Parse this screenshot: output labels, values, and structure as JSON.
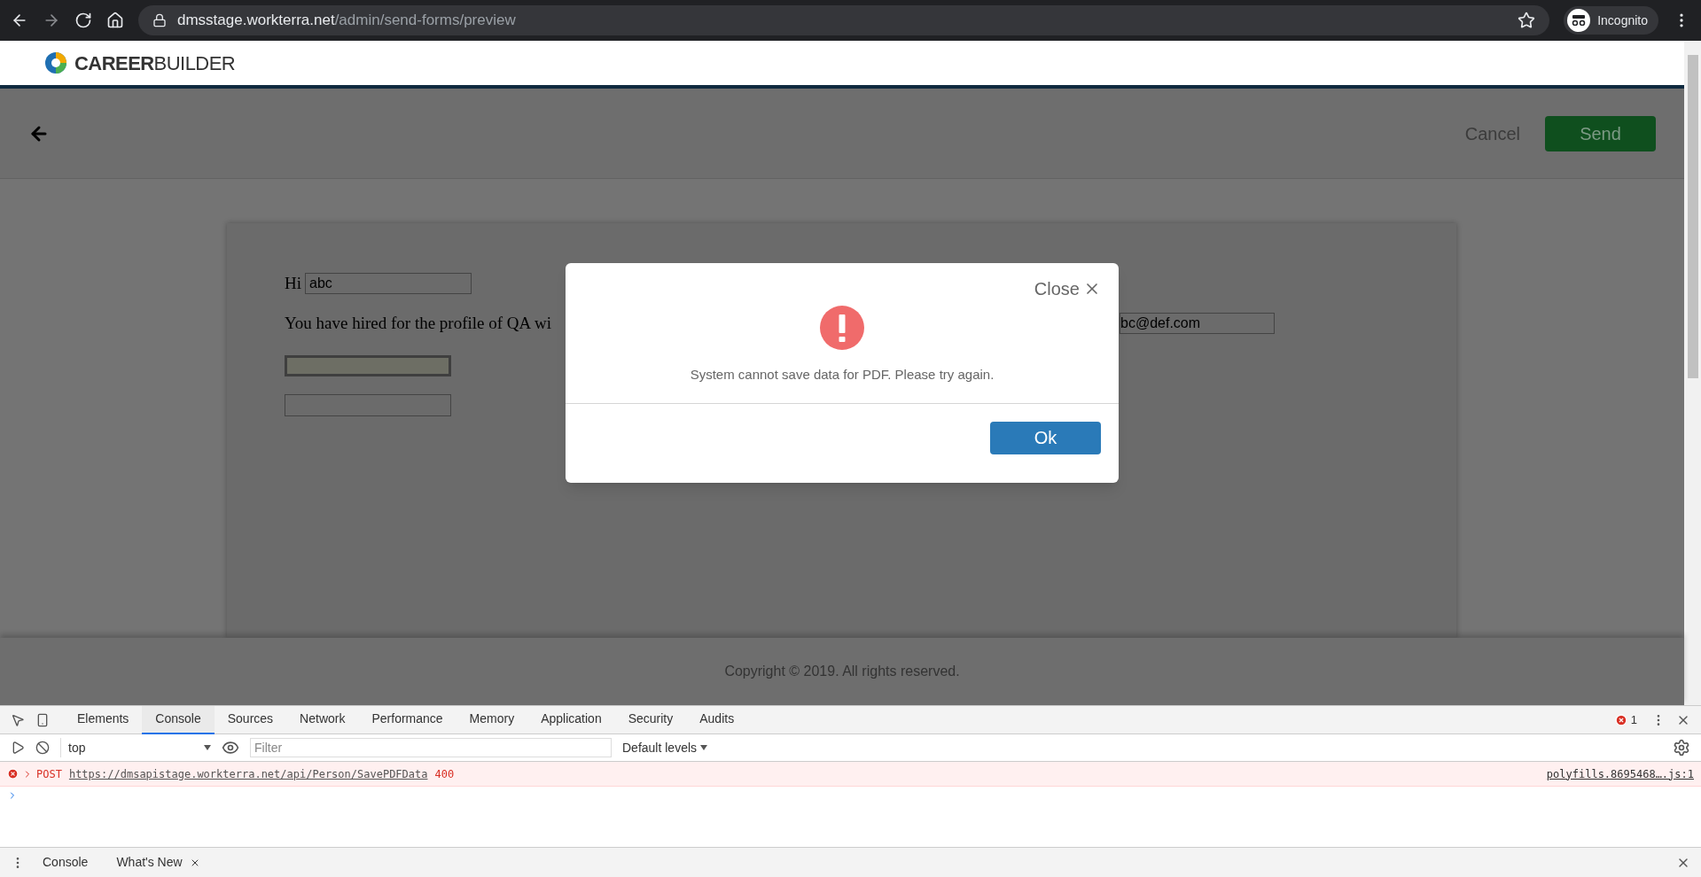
{
  "browser": {
    "url_host": "dmsstage.workterra.net",
    "url_path": "/admin/send-forms/preview",
    "profile": "Incognito"
  },
  "header": {
    "logo": "**CAREER**BUILDER"
  },
  "toolbar": {
    "cancel": "Cancel",
    "send": "Send"
  },
  "document": {
    "greeting": "Hi",
    "name_value": "abc",
    "sentence": "You have hired for the profile of QA wi",
    "email_value": "bc@def.com"
  },
  "footer": "Copyright © 2019. All rights reserved.",
  "dialog": {
    "close": "Close",
    "message": "System cannot save data for PDF. Please try again.",
    "ok": "Ok"
  },
  "devtools": {
    "tabs": [
      {
        "label": "Elements",
        "selected": false
      },
      {
        "label": "Console",
        "selected": true
      },
      {
        "label": "Sources",
        "selected": false
      },
      {
        "label": "Network",
        "selected": false
      },
      {
        "label": "Performance",
        "selected": false
      },
      {
        "label": "Memory",
        "selected": false
      },
      {
        "label": "Application",
        "selected": false
      },
      {
        "label": "Security",
        "selected": false
      },
      {
        "label": "Audits",
        "selected": false
      }
    ],
    "error_count": "1",
    "context": "top",
    "filter_placeholder": "Filter",
    "levels": "Default levels",
    "messages": [
      {
        "method": "POST",
        "url": "https://dmsapistage.workterra.net/api/Person/SavePDFData",
        "status": "400",
        "source": "polyfills.8695468….js:1"
      }
    ],
    "drawer_tabs": [
      {
        "label": "Console",
        "closable": false
      },
      {
        "label": "What's New",
        "closable": true
      }
    ]
  }
}
